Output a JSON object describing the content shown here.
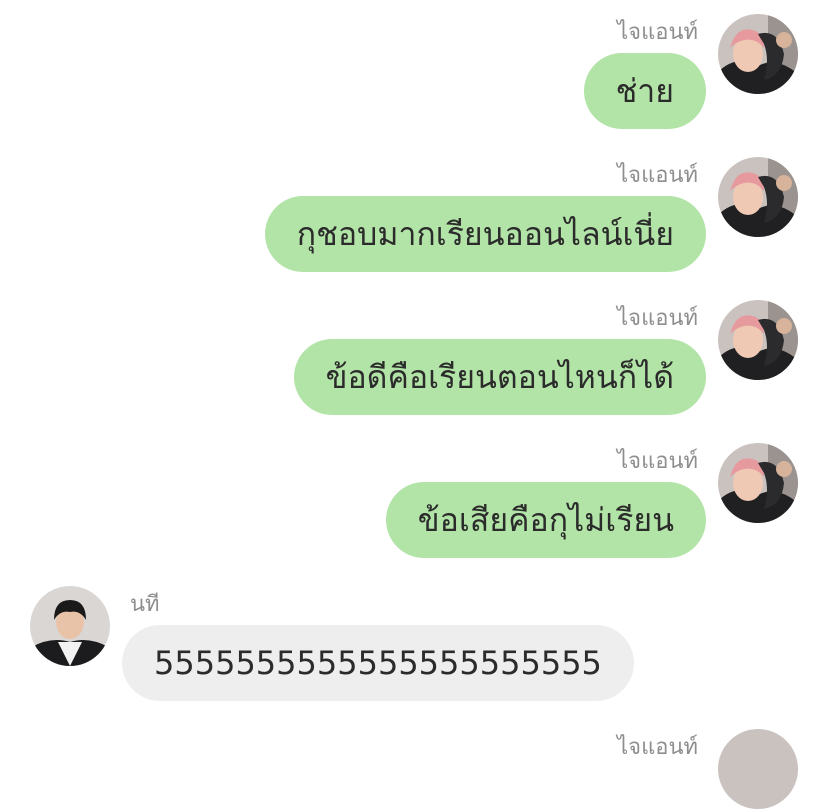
{
  "messages": [
    {
      "sender": "ไจแอนท์",
      "text": "ช่าย",
      "direction": "outgoing"
    },
    {
      "sender": "ไจแอนท์",
      "text": "กุชอบมากเรียนออนไลน์เนี่ย",
      "direction": "outgoing"
    },
    {
      "sender": "ไจแอนท์",
      "text": "ข้อดีคือเรียนตอนไหนก็ได้",
      "direction": "outgoing"
    },
    {
      "sender": "ไจแอนท์",
      "text": "ข้อเสียคือกุไม่เรียน",
      "direction": "outgoing"
    },
    {
      "sender": "นที",
      "text": "5555555555555555555555",
      "direction": "incoming"
    },
    {
      "sender": "ไจแอนท์",
      "text": "",
      "direction": "outgoing"
    }
  ],
  "colors": {
    "outgoing_bubble": "#b2e4a7",
    "incoming_bubble": "#eeeeee",
    "sender_name": "#8e8e8e",
    "message_text": "#2b2b2b",
    "background": "#ffffff"
  },
  "avatars": {
    "outgoing": "user-avatar-pink-hair-hoodie",
    "incoming": "user-avatar-dark-hair"
  }
}
